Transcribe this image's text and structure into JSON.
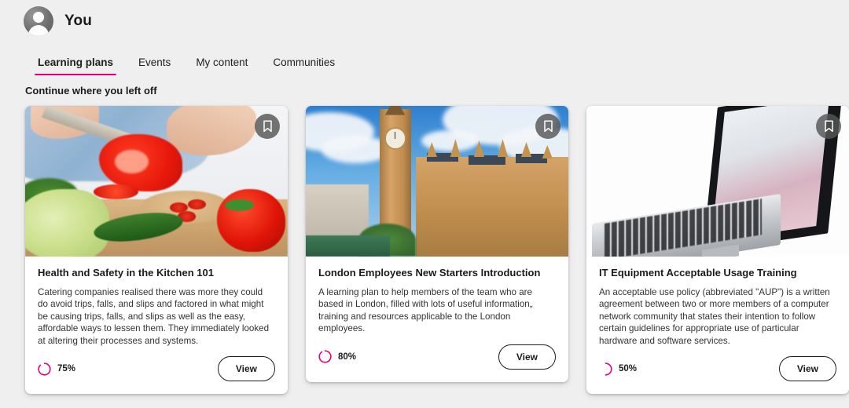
{
  "header": {
    "avatar_icon": "user-avatar-icon",
    "user_name": "You"
  },
  "tabs": [
    {
      "label": "Learning plans",
      "active": true
    },
    {
      "label": "Events",
      "active": false
    },
    {
      "label": "My content",
      "active": false
    },
    {
      "label": "Communities",
      "active": false
    }
  ],
  "section": {
    "title": "Continue where you left off"
  },
  "colors": {
    "accent": "#e0007a",
    "progress": "#e8007d",
    "page_background": "#efeff0",
    "card_background": "#ffffff",
    "text": "#1b1b1b"
  },
  "cards": [
    {
      "thumbnail": "kitchen-vegetables-image",
      "bookmark_icon": "bookmark-icon",
      "title": "Health and Safety in the Kitchen 101",
      "description": "Catering companies realised there was more they could do avoid trips, falls, and slips and factored in what might be causing trips, falls, and slips as well as the easy, affordable ways to lessen them. They immediately looked at altering their processes and systems.",
      "progress_percent": 75,
      "progress_label": "75%",
      "view_label": "View"
    },
    {
      "thumbnail": "london-big-ben-image",
      "bookmark_icon": "bookmark-icon",
      "title": "London Employees New Starters Introduction",
      "description": "A learning plan to help members of the team who are based in London, filled with lots of useful information„ training and resources applicable to the London employees.",
      "progress_percent": 80,
      "progress_label": "80%",
      "view_label": "View"
    },
    {
      "thumbnail": "laptop-computer-image",
      "bookmark_icon": "bookmark-icon",
      "title": "IT Equipment Acceptable Usage Training",
      "description": "An acceptable use policy (abbreviated \"AUP\") is a written agreement between two or more members of a computer network community that states their intention to follow certain guidelines for appropriate use of particular hardware and software services.",
      "progress_percent": 50,
      "progress_label": "50%",
      "view_label": "View"
    }
  ]
}
